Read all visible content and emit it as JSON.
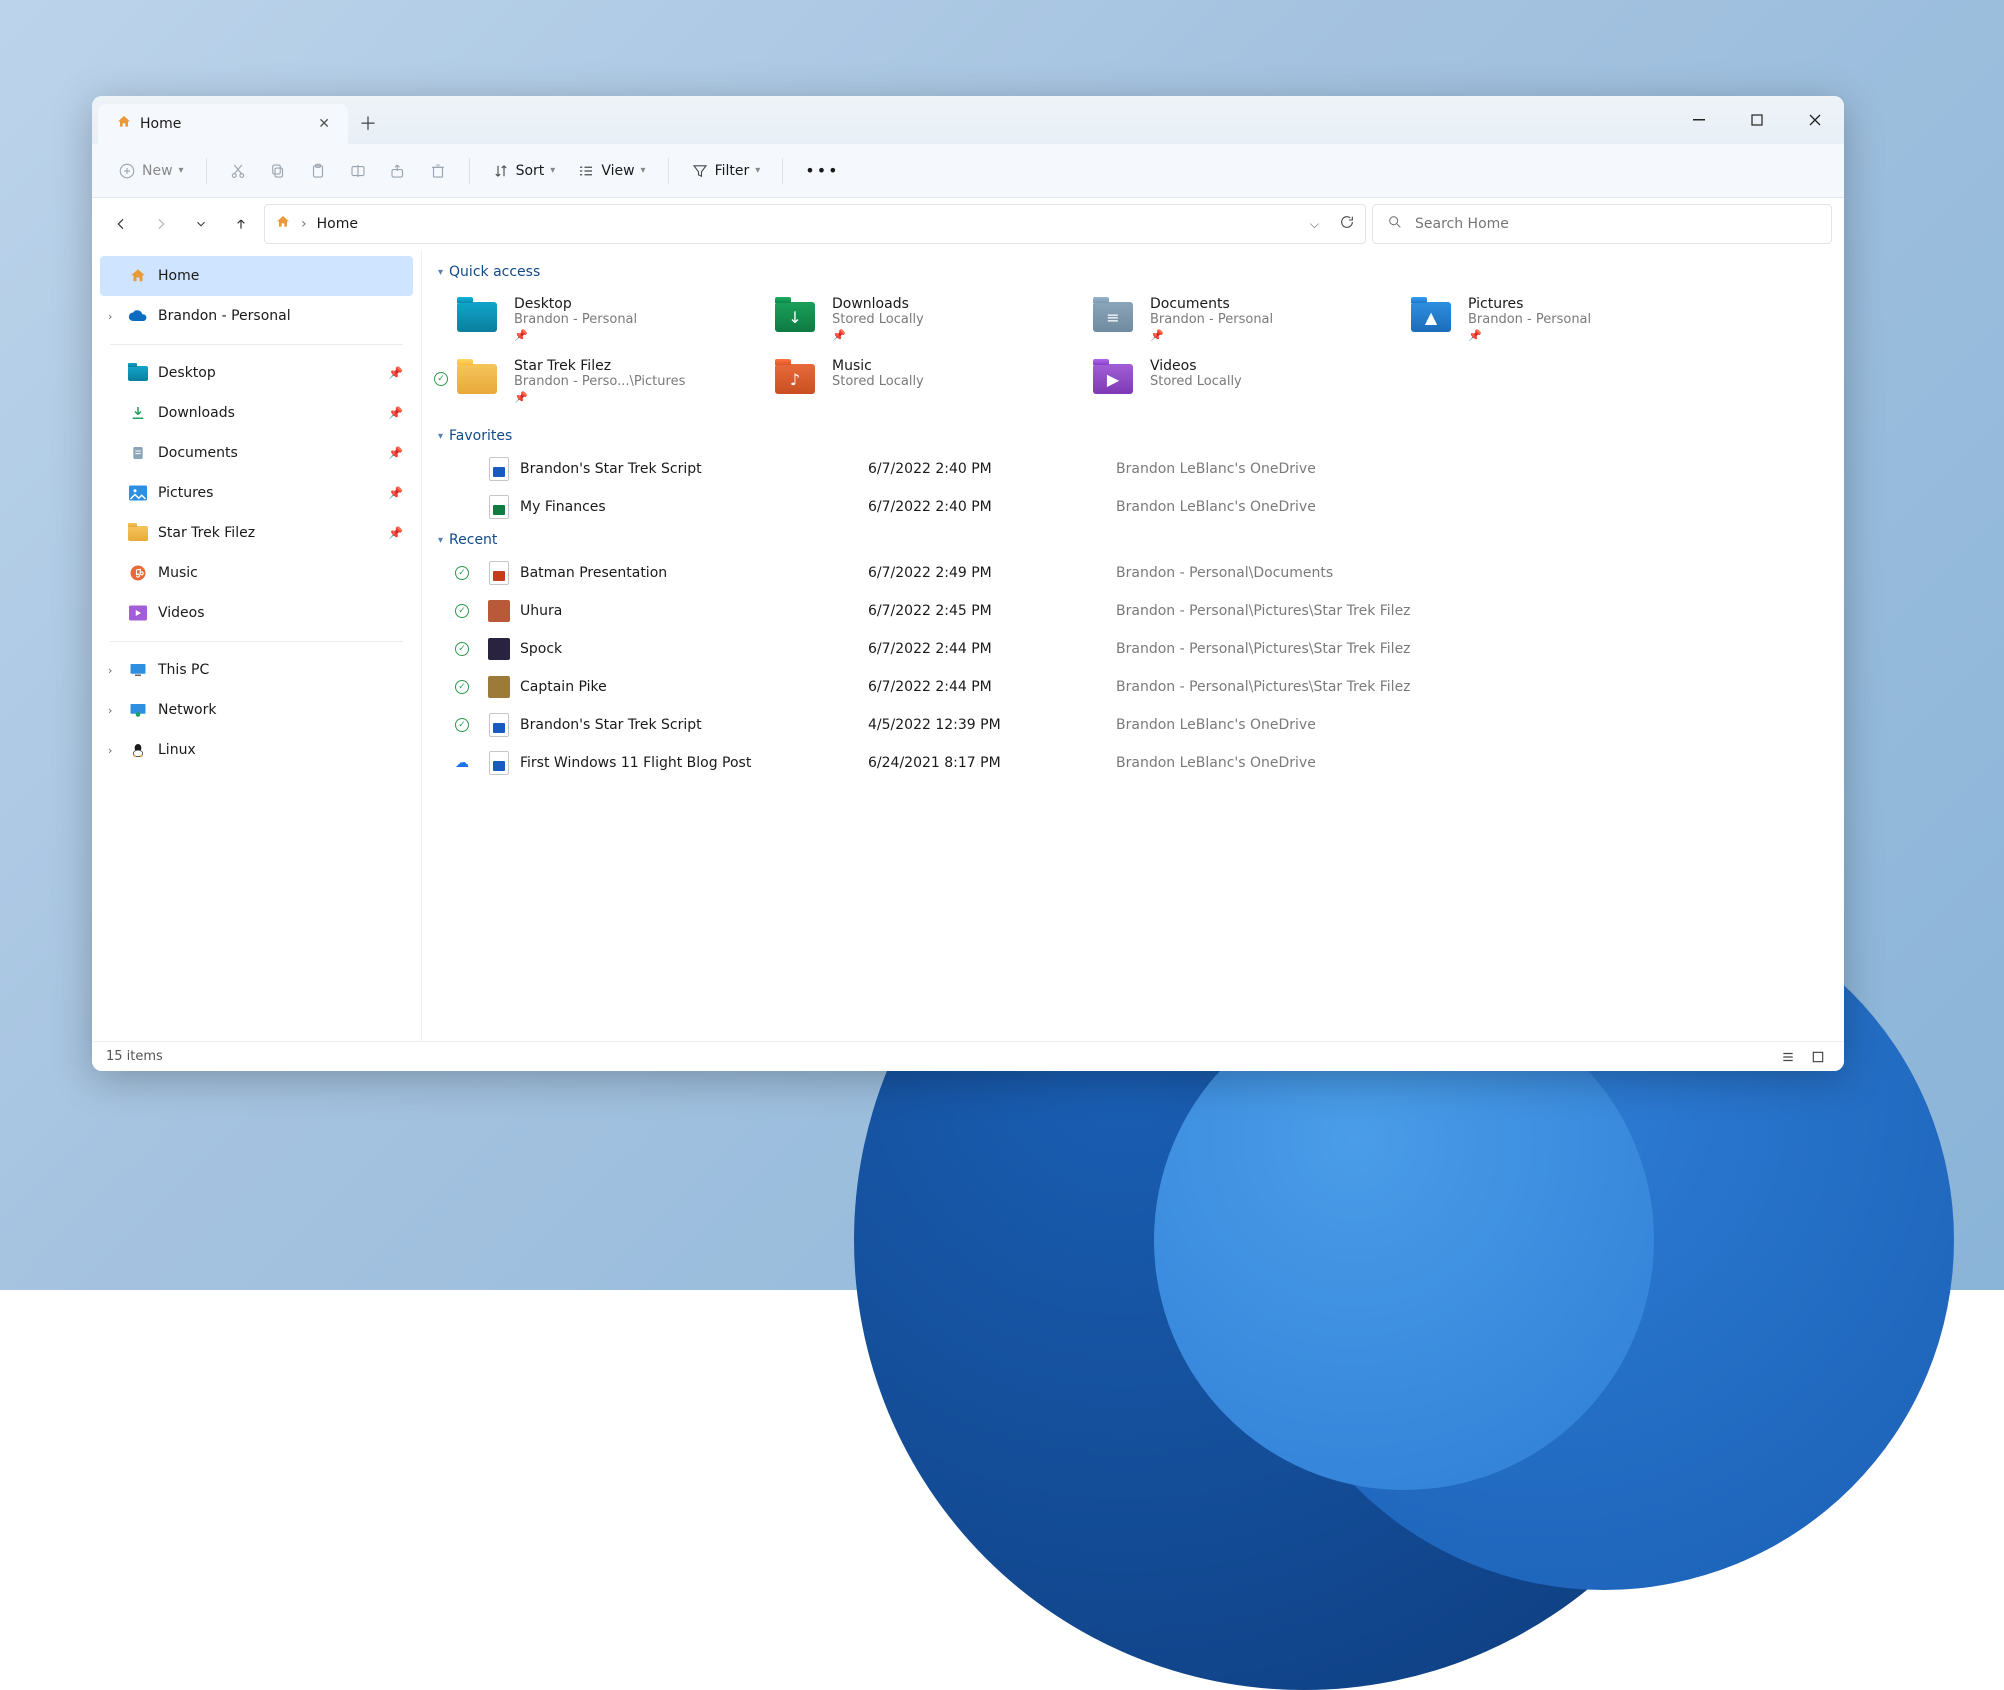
{
  "tab": {
    "title": "Home"
  },
  "toolbar": {
    "new_label": "New",
    "sort_label": "Sort",
    "view_label": "View",
    "filter_label": "Filter"
  },
  "addressbar": {
    "location": "Home"
  },
  "search": {
    "placeholder": "Search Home"
  },
  "sidebar": {
    "top": [
      {
        "label": "Home",
        "icon": "home",
        "selected": true,
        "expandable": false
      },
      {
        "label": "Brandon - Personal",
        "icon": "onedrive",
        "expandable": true
      }
    ],
    "pinned": [
      {
        "label": "Desktop",
        "icon": "desktop",
        "pinned": true
      },
      {
        "label": "Downloads",
        "icon": "downloads",
        "pinned": true
      },
      {
        "label": "Documents",
        "icon": "documents",
        "pinned": true
      },
      {
        "label": "Pictures",
        "icon": "pictures",
        "pinned": true
      },
      {
        "label": "Star Trek Filez",
        "icon": "folder",
        "pinned": true
      },
      {
        "label": "Music",
        "icon": "music",
        "pinned": false
      },
      {
        "label": "Videos",
        "icon": "videos",
        "pinned": false
      }
    ],
    "bottom": [
      {
        "label": "This PC",
        "icon": "pc",
        "expandable": true
      },
      {
        "label": "Network",
        "icon": "network",
        "expandable": true
      },
      {
        "label": "Linux",
        "icon": "linux",
        "expandable": true
      }
    ]
  },
  "sections": {
    "quick_access": {
      "title": "Quick access",
      "items": [
        {
          "name": "Desktop",
          "sub": "Brandon - Personal",
          "icon": "desktop",
          "pinned": true,
          "synced": false
        },
        {
          "name": "Downloads",
          "sub": "Stored Locally",
          "icon": "downloads",
          "pinned": true,
          "synced": false
        },
        {
          "name": "Documents",
          "sub": "Brandon - Personal",
          "icon": "documents",
          "pinned": true,
          "synced": false
        },
        {
          "name": "Pictures",
          "sub": "Brandon - Personal",
          "icon": "pictures",
          "pinned": true,
          "synced": false
        },
        {
          "name": "Star Trek Filez",
          "sub": "Brandon - Perso...\\Pictures",
          "icon": "startrek",
          "pinned": true,
          "synced": true
        },
        {
          "name": "Music",
          "sub": "Stored Locally",
          "icon": "music",
          "pinned": false,
          "synced": false
        },
        {
          "name": "Videos",
          "sub": "Stored Locally",
          "icon": "videos",
          "pinned": false,
          "synced": false
        }
      ]
    },
    "favorites": {
      "title": "Favorites",
      "items": [
        {
          "name": "Brandon's Star Trek Script",
          "type": "word",
          "date": "6/7/2022 2:40 PM",
          "location": "Brandon LeBlanc's OneDrive"
        },
        {
          "name": "My Finances",
          "type": "excel",
          "date": "6/7/2022 2:40 PM",
          "location": "Brandon LeBlanc's OneDrive"
        }
      ]
    },
    "recent": {
      "title": "Recent",
      "items": [
        {
          "name": "Batman Presentation",
          "type": "ppt",
          "status": "synced",
          "date": "6/7/2022 2:49 PM",
          "location": "Brandon - Personal\\Documents"
        },
        {
          "name": "Uhura",
          "type": "image",
          "color": "#b85a3a",
          "status": "synced",
          "date": "6/7/2022 2:45 PM",
          "location": "Brandon - Personal\\Pictures\\Star Trek Filez"
        },
        {
          "name": "Spock",
          "type": "image",
          "color": "#2a2340",
          "status": "synced",
          "date": "6/7/2022 2:44 PM",
          "location": "Brandon - Personal\\Pictures\\Star Trek Filez"
        },
        {
          "name": "Captain Pike",
          "type": "image",
          "color": "#9c7a3a",
          "status": "synced",
          "date": "6/7/2022 2:44 PM",
          "location": "Brandon - Personal\\Pictures\\Star Trek Filez"
        },
        {
          "name": "Brandon's Star Trek Script",
          "type": "word",
          "status": "synced",
          "date": "4/5/2022 12:39 PM",
          "location": "Brandon LeBlanc's OneDrive"
        },
        {
          "name": "First Windows 11 Flight Blog Post",
          "type": "word",
          "status": "cloud",
          "date": "6/24/2021 8:17 PM",
          "location": "Brandon LeBlanc's OneDrive"
        }
      ]
    }
  },
  "statusbar": {
    "count": "15 items"
  }
}
